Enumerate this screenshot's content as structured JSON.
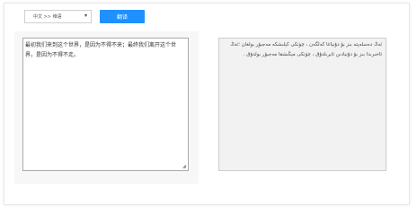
{
  "toolbar": {
    "language_pair": "中文 >> 维语",
    "translate_label": "翻译"
  },
  "source": {
    "text": "最初我们来到这个世界，是因为不得不来；最终我们离开这个世界，是因为不得不走。"
  },
  "target": {
    "text": "ئەڭ دەسلەپتە بىز بۇ دۇنياغا كەلگەن ، چۈنكى كېلىشكە مەجبۇر بولغان ؛ئەڭ ئاخىرىدا بىز بۇ دۇنيادىن ئايرىلدۇق ، چۈنكى مېڭىشقا مەجبۇر بولدۇق ."
  },
  "colors": {
    "accent": "#1e90ff",
    "panel_bg": "#f7f7f7",
    "target_bg": "#f2f2f2"
  }
}
